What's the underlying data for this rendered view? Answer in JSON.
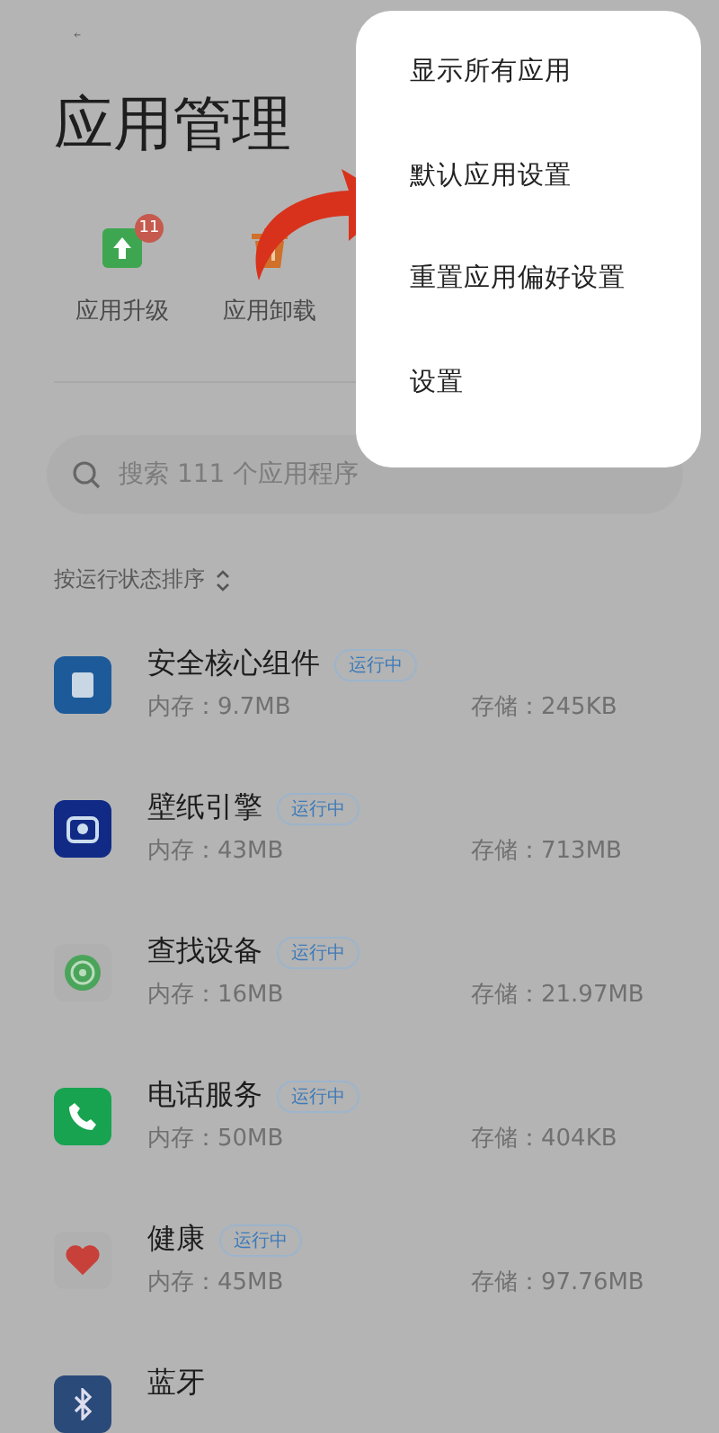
{
  "header": {
    "title": "应用管理"
  },
  "quick_actions": [
    {
      "kind": "upgrade",
      "label": "应用升级",
      "badge": "11"
    },
    {
      "kind": "uninstall",
      "label": "应用卸载"
    }
  ],
  "search": {
    "placeholder": "搜索 111 个应用程序"
  },
  "sort": {
    "label": "按运行状态排序"
  },
  "apps": [
    {
      "kind": "security",
      "name": "安全核心组件",
      "status": "运行中",
      "memory": "内存：9.7MB",
      "storage": "存储：245KB"
    },
    {
      "kind": "wallpaper",
      "name": "壁纸引擎",
      "status": "运行中",
      "memory": "内存：43MB",
      "storage": "存储：713MB"
    },
    {
      "kind": "find",
      "name": "查找设备",
      "status": "运行中",
      "memory": "内存：16MB",
      "storage": "存储：21.97MB"
    },
    {
      "kind": "phone",
      "name": "电话服务",
      "status": "运行中",
      "memory": "内存：50MB",
      "storage": "存储：404KB"
    },
    {
      "kind": "health",
      "name": "健康",
      "status": "运行中",
      "memory": "内存：45MB",
      "storage": "存储：97.76MB"
    },
    {
      "kind": "bluetooth",
      "name": "蓝牙"
    }
  ],
  "menu": {
    "items": [
      "显示所有应用",
      "默认应用设置",
      "重置应用偏好设置",
      "设置"
    ]
  }
}
